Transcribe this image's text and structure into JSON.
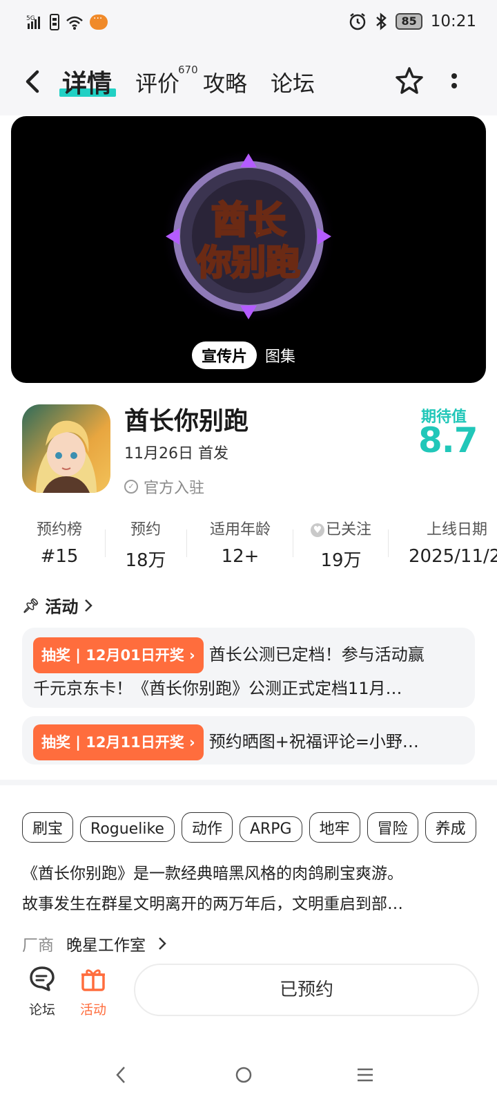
{
  "status_bar": {
    "network": "5G",
    "wifi": "6",
    "battery": "85",
    "time": "10:21"
  },
  "nav": {
    "tabs": [
      {
        "label": "详情",
        "active": true
      },
      {
        "label": "评价",
        "count": "670"
      },
      {
        "label": "攻略"
      },
      {
        "label": "论坛"
      }
    ]
  },
  "media": {
    "logo_text": "酋长你别跑",
    "options": [
      "宣传片",
      "图集"
    ]
  },
  "app": {
    "name": "酋长你别跑",
    "release": "11月26日 首发",
    "official": "官方入驻",
    "expect_label": "期待值",
    "expect_score": "8.7"
  },
  "stats": [
    {
      "label": "预约榜",
      "value": "#15"
    },
    {
      "label": "预约",
      "value": "18万"
    },
    {
      "label": "适用年龄",
      "value": "12+"
    },
    {
      "label": "已关注",
      "value": "19万"
    },
    {
      "label": "上线日期",
      "value": "2025/11/2"
    }
  ],
  "activities": {
    "title": "活动",
    "items": [
      {
        "badge": "抽奖 | 12月01日开奖 ›",
        "text1": "酋长公测已定档！参与活动赢",
        "text2": "千元京东卡！《酋长你别跑》公测正式定档11月…"
      },
      {
        "badge": "抽奖 | 12月11日开奖 ›",
        "text1": "预约晒图+祝福评论=小野…"
      }
    ]
  },
  "tags": [
    "刷宝",
    "Roguelike",
    "动作",
    "ARPG",
    "地牢",
    "冒险",
    "养成"
  ],
  "description": {
    "line1": "《酋长你别跑》是一款经典暗黑风格的肉鸽刷宝爽游。",
    "line2": "故事发生在群星文明离开的两万年后，文明重启到部…"
  },
  "vendor": {
    "label": "厂商",
    "name": "晚星工作室"
  },
  "bottom": {
    "forum": "论坛",
    "activity": "活动",
    "reserve": "已预约",
    "activity_color": "#ff6d3d"
  },
  "colors": {
    "accent": "#22d0c4",
    "score": "#21c7b9",
    "badge": "#ff6d3d"
  }
}
